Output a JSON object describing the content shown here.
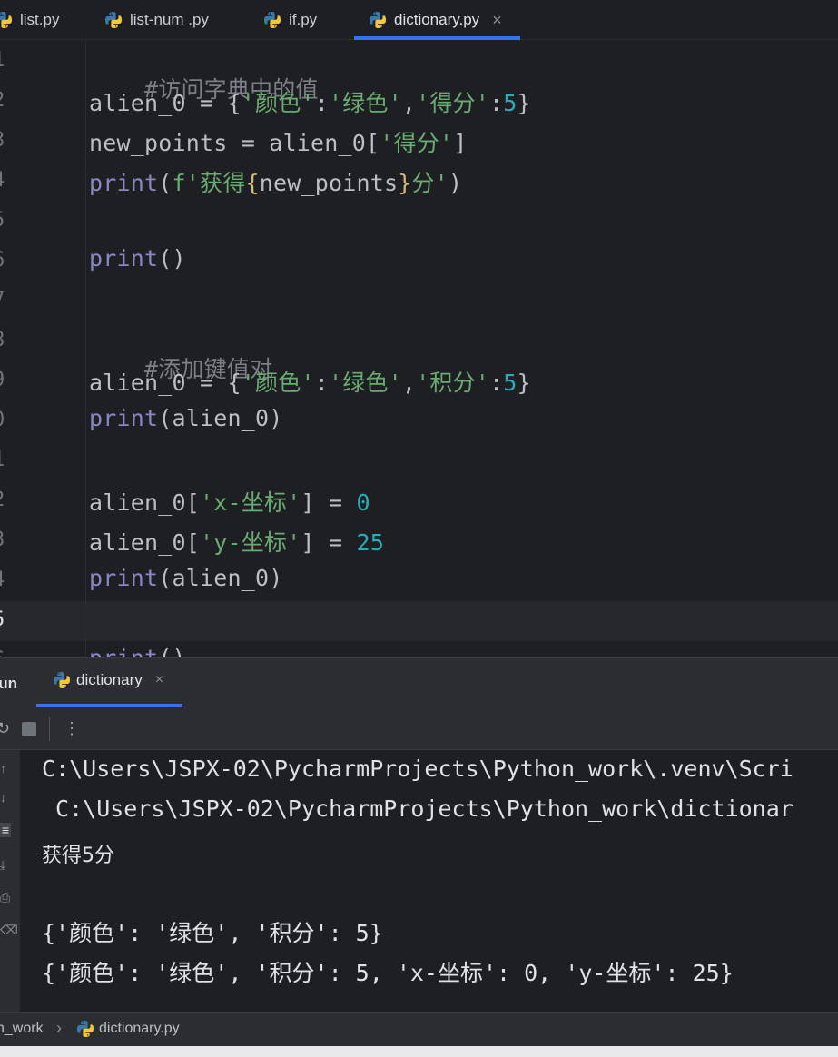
{
  "editor_tabs": [
    {
      "label": "list.py",
      "active": false
    },
    {
      "label": "list-num .py",
      "active": false
    },
    {
      "label": "if.py",
      "active": false
    },
    {
      "label": "dictionary.py",
      "active": true
    }
  ],
  "tab_close_glyph": "×",
  "gutter": [
    "1",
    "2",
    "3",
    "4",
    "5",
    "6",
    "7",
    "8",
    "9",
    "0",
    "1",
    "2",
    "3",
    "4",
    "5",
    "6"
  ],
  "code": {
    "l1_comment": "#访问字典中的值",
    "l2": {
      "var": "alien_0",
      "op": " = {",
      "s1": "'颜色'",
      "colon1": ":",
      "s2": "'绿色'",
      "comma": ",",
      "s3": "'得分'",
      "colon2": ":",
      "n": "5",
      "end": "}"
    },
    "l3": {
      "var": "new_points = alien_0[",
      "s": "'得分'",
      "end": "]"
    },
    "l4": {
      "fn": "print",
      "open": "(",
      "fpre": "f'获得",
      "b1": "{",
      "inner": "new_points",
      "b2": "}",
      "fpost": "分'",
      "close": ")"
    },
    "l6": {
      "fn": "print",
      "rest": "()"
    },
    "l8_comment": "#添加键值对",
    "l9": {
      "var": "alien_0",
      "op": " = {",
      "s1": "'颜色'",
      "colon1": ":",
      "s2": "'绿色'",
      "comma": ",",
      "s3": "'积分'",
      "colon2": ":",
      "n": "5",
      "end": "}"
    },
    "l10": {
      "fn": "print",
      "rest": "(alien_0)"
    },
    "l12": {
      "pre": "alien_0[",
      "s": "'x-坐标'",
      "mid": "] = ",
      "n": "0"
    },
    "l13": {
      "pre": "alien_0[",
      "s": "'y-坐标'",
      "mid": "] = ",
      "n": "25"
    },
    "l14": {
      "fn": "print",
      "rest": "(alien_0)"
    },
    "l16": {
      "fn": "print",
      "rest": "()"
    }
  },
  "run_panel": {
    "label": "Run",
    "tab_label": "dictionary",
    "close_glyph": "×",
    "toolbar_more": "⋮",
    "toolbar_rerun": "↻"
  },
  "console_lines": [
    "C:\\Users\\JSPX-02\\PycharmProjects\\Python_work\\.venv\\Scri",
    " C:\\Users\\JSPX-02\\PycharmProjects\\Python_work\\dictionar",
    "获得5分",
    "",
    "{'颜色': '绿色', '积分': 5}",
    "{'颜色': '绿色', '积分': 5, 'x-坐标': 0, 'y-坐标': 25}"
  ],
  "breadcrumb": {
    "project": "n_work",
    "separator": "›",
    "file": "dictionary.py"
  },
  "colors": {
    "background": "#1e1f22",
    "panel": "#2b2d30",
    "accent": "#3574f0",
    "string": "#6aab73",
    "number": "#2aacb8",
    "builtin": "#8888c6",
    "comment": "#7a7e85"
  }
}
